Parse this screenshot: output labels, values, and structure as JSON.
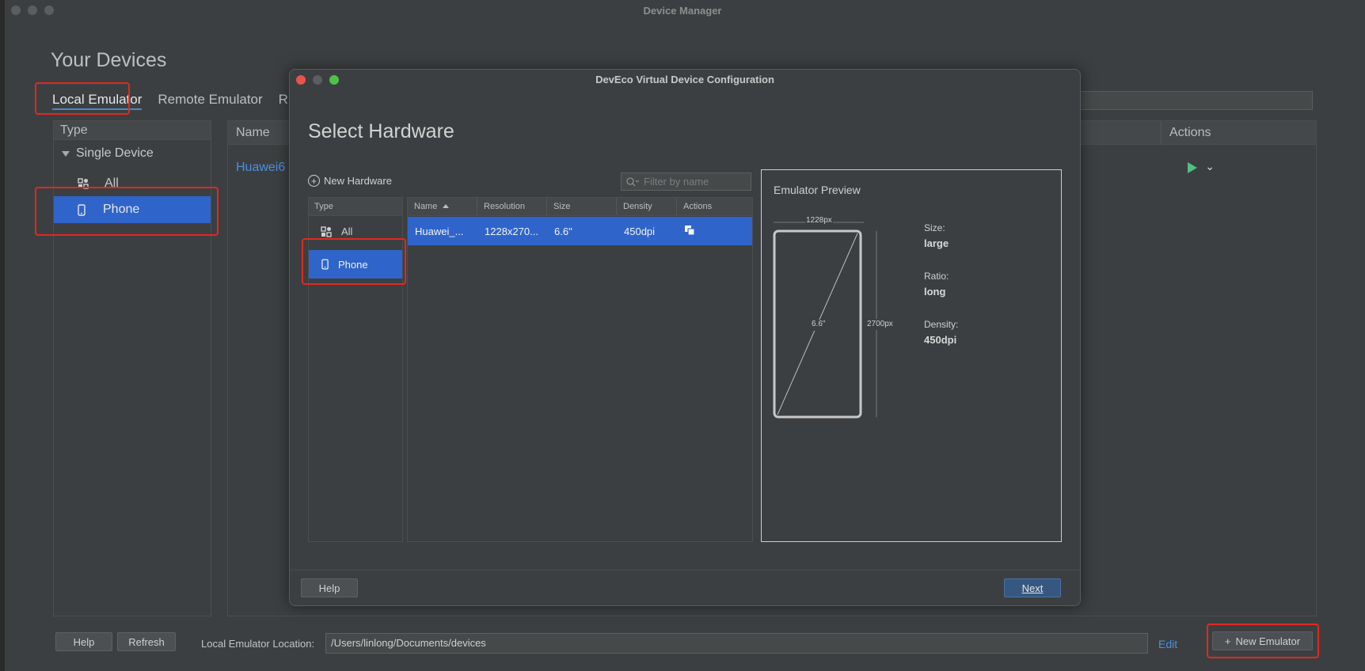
{
  "window": {
    "title": "Device Manager",
    "heading": "Your Devices",
    "tabs": [
      {
        "label": "Local Emulator",
        "active": true
      },
      {
        "label": "Remote Emulator",
        "active": false
      },
      {
        "label": "R",
        "active": false
      }
    ]
  },
  "type_panel": {
    "header": "Type",
    "group": "Single Device",
    "items": [
      {
        "label": "All",
        "icon": "shapes-icon",
        "selected": false
      },
      {
        "label": "Phone",
        "icon": "phone-icon",
        "selected": true
      }
    ]
  },
  "device_table": {
    "columns": {
      "name": "Name",
      "actions": "Actions"
    },
    "rows": [
      {
        "name": "Huawei6"
      }
    ]
  },
  "bottom": {
    "help_label": "Help",
    "refresh_label": "Refresh",
    "location_label": "Local Emulator Location:",
    "location_value": "/Users/linlong/Documents/devices",
    "edit_label": "Edit",
    "new_emulator_label": "New Emulator"
  },
  "dialog": {
    "title": "DevEco Virtual Device Configuration",
    "heading": "Select Hardware",
    "new_hardware_label": "New Hardware",
    "filter_placeholder": "Filter by name",
    "type_header": "Type",
    "type_items": [
      {
        "label": "All",
        "icon": "shapes-icon",
        "selected": false
      },
      {
        "label": "Phone",
        "icon": "phone-icon",
        "selected": true
      }
    ],
    "table_columns": [
      "Name",
      "Resolution",
      "Size",
      "Density",
      "Actions"
    ],
    "table_rows": [
      {
        "name": "Huawei_...",
        "resolution": "1228x270...",
        "size": "6.6\"",
        "density": "450dpi",
        "selected": true
      }
    ],
    "preview": {
      "title": "Emulator Preview",
      "width_label": "1228px",
      "height_label": "2700px",
      "diagonal_label": "6.6\"",
      "size_label": "Size:",
      "size_value": "large",
      "ratio_label": "Ratio:",
      "ratio_value": "long",
      "density_label": "Density:",
      "density_value": "450dpi"
    },
    "help_label": "Help",
    "next_label": "Next"
  },
  "colors": {
    "accent": "#2f65ca",
    "highlight": "#e0291f",
    "link": "#4d8fe0",
    "play": "#4fbf86"
  }
}
